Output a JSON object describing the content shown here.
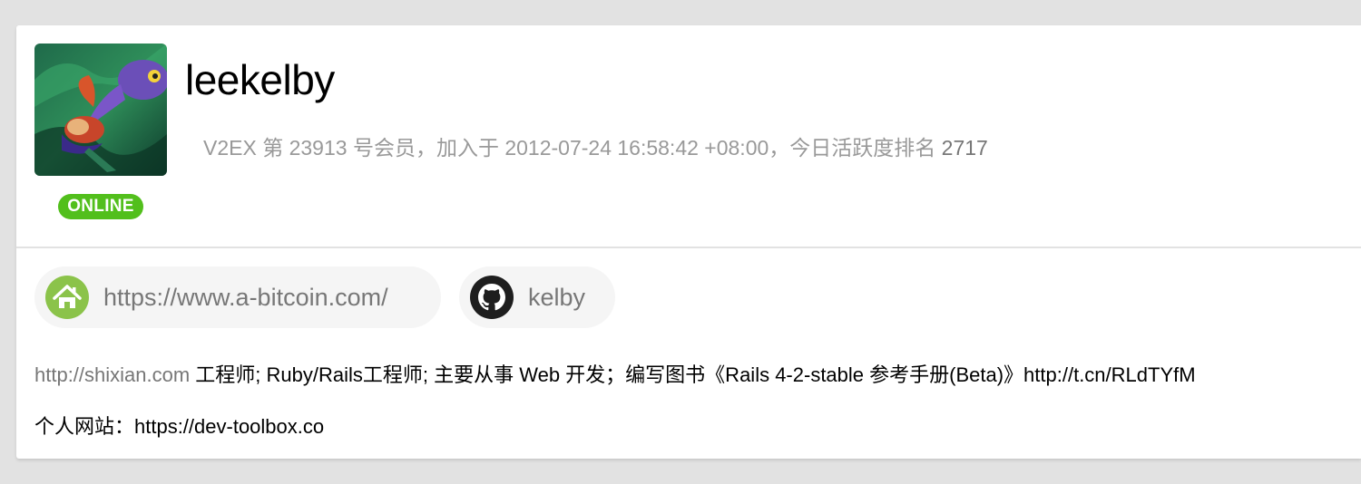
{
  "profile": {
    "username": "leekelby",
    "status_badge": "ONLINE",
    "member_info": {
      "prefix": "V2EX 第 23913 号会员，加入于 2012-07-24 16:58:42 +08:00，今日活跃度排名 ",
      "rank": "2717"
    }
  },
  "links": {
    "homepage": {
      "icon": "home-icon",
      "text": "https://www.a-bitcoin.com/"
    },
    "github": {
      "icon": "github-icon",
      "text": "kelby"
    }
  },
  "bio": {
    "link_text": "http://shixian.com",
    "text": " 工程师; Ruby/Rails工程师; 主要从事 Web 开发；编写图书《Rails 4-2-stable 参考手册(Beta)》http://t.cn/RLdTYfM",
    "site_line": "个人网站：https://dev-toolbox.co"
  },
  "colors": {
    "online_badge": "#52bf1c",
    "home_icon_bg": "#8bc34a",
    "github_icon_bg": "#1e1e1e",
    "muted_text": "#999999",
    "pill_bg": "#f5f5f5"
  }
}
